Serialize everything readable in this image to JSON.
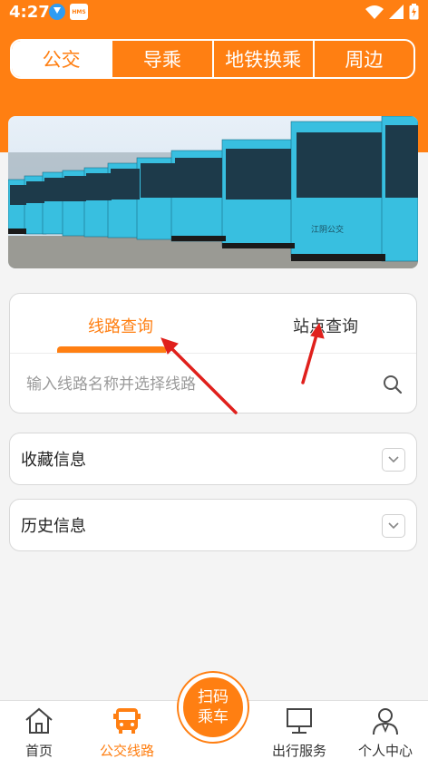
{
  "status_bar": {
    "time": "4:27",
    "msg_badge": "HMS"
  },
  "top_tabs": [
    {
      "label": "公交",
      "active": true
    },
    {
      "label": "导乘",
      "active": false
    },
    {
      "label": "地铁换乘",
      "active": false
    },
    {
      "label": "周边",
      "active": false
    }
  ],
  "banner": {
    "bus_sign": "江阴公交"
  },
  "search": {
    "tabs": [
      {
        "label": "线路查询",
        "active": true
      },
      {
        "label": "站点查询",
        "active": false
      }
    ],
    "placeholder": "输入线路名称并选择线路"
  },
  "favorites": {
    "label": "收藏信息"
  },
  "history": {
    "label": "历史信息"
  },
  "bottom_nav": {
    "home": "首页",
    "bus_lines": "公交线路",
    "scan_line1": "扫码",
    "scan_line2": "乘车",
    "travel": "出行服务",
    "profile": "个人中心"
  },
  "colors": {
    "accent": "#ff7f12",
    "annotation": "#e0201c"
  }
}
